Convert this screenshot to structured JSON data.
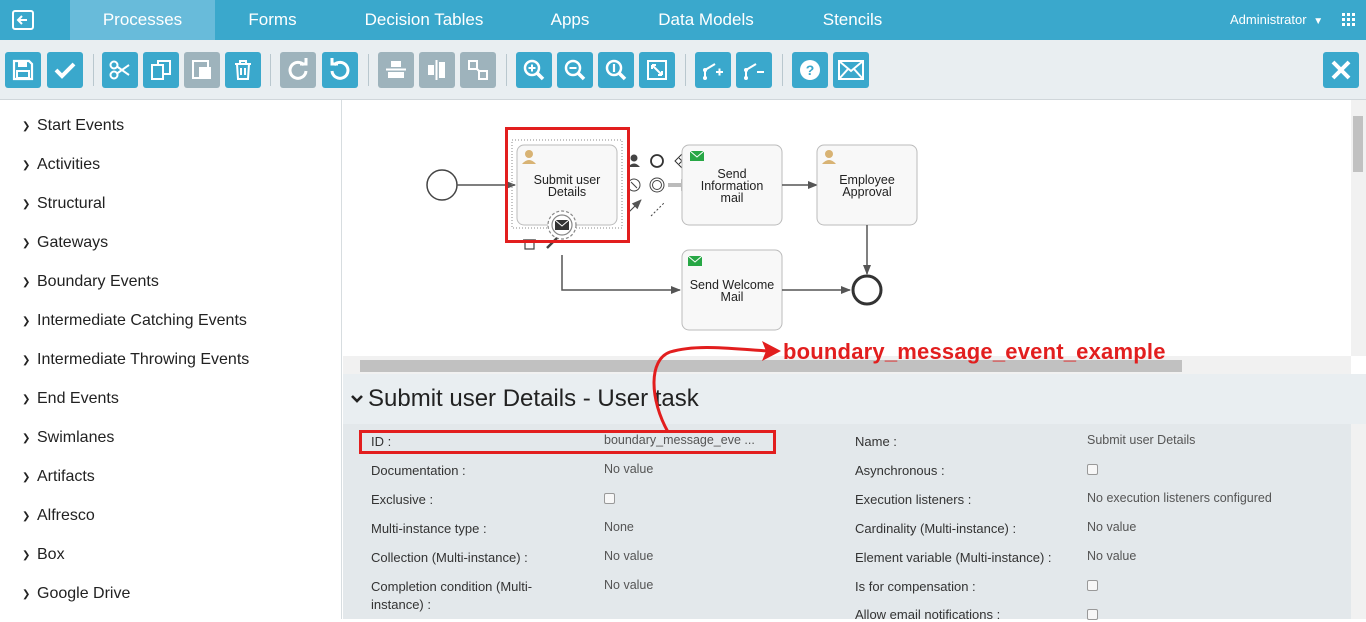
{
  "nav": {
    "tabs": [
      "Processes",
      "Forms",
      "Decision Tables",
      "Apps",
      "Data Models",
      "Stencils"
    ],
    "active_tab": "Processes",
    "user": "Administrator",
    "colors": {
      "bar": "#3aa8cc",
      "active": "#68bbda"
    }
  },
  "toolbar": {
    "icons": [
      "save-icon",
      "validate-icon",
      "cut-icon",
      "copy-icon",
      "paste-icon",
      "delete-icon",
      "redo-icon",
      "undo-icon",
      "align-horizontal-icon",
      "align-vertical-icon",
      "same-size-icon",
      "zoom-in-icon",
      "zoom-out-icon",
      "zoom-actual-icon",
      "zoom-fit-icon",
      "add-bendpoint-icon",
      "remove-bendpoint-icon",
      "help-icon",
      "feedback-mail-icon",
      "close-icon"
    ]
  },
  "palette": {
    "items": [
      "Start Events",
      "Activities",
      "Structural",
      "Gateways",
      "Boundary Events",
      "Intermediate Catching Events",
      "Intermediate Throwing Events",
      "End Events",
      "Swimlanes",
      "Artifacts",
      "Alfresco",
      "Box",
      "Google Drive"
    ]
  },
  "diagram": {
    "tasks": {
      "submit": [
        "Submit user",
        "Details"
      ],
      "send_info": [
        "Send",
        "Information",
        "mail"
      ],
      "employee": [
        "Employee",
        "Approval"
      ],
      "welcome": [
        "Send Welcome",
        "Mail"
      ]
    }
  },
  "annotation": {
    "label": "boundary_message_event_example",
    "color": "#e21e1e"
  },
  "properties": {
    "title": "Submit user Details - User task",
    "left": [
      {
        "label": "ID :",
        "value": "boundary_message_eve ..."
      },
      {
        "label": "Documentation :",
        "value": "No value"
      },
      {
        "label": "Exclusive :",
        "checkbox": true
      },
      {
        "label": "Multi-instance type :",
        "value": "None"
      },
      {
        "label": "Collection (Multi-instance) :",
        "value": "No value"
      },
      {
        "label": "Completion condition (Multi-",
        "label2": "instance) :",
        "value": "No value"
      }
    ],
    "right": [
      {
        "label": "Name :",
        "value": "Submit user Details"
      },
      {
        "label": "Asynchronous :",
        "checkbox": true
      },
      {
        "label": "Execution listeners :",
        "value": "No execution listeners configured"
      },
      {
        "label": "Cardinality (Multi-instance) :",
        "value": "No value"
      },
      {
        "label": "Element variable (Multi-instance) :",
        "value": "No value"
      },
      {
        "label": "Is for compensation :",
        "checkbox": true
      },
      {
        "label": "Allow email notifications :",
        "checkbox": true
      }
    ]
  }
}
